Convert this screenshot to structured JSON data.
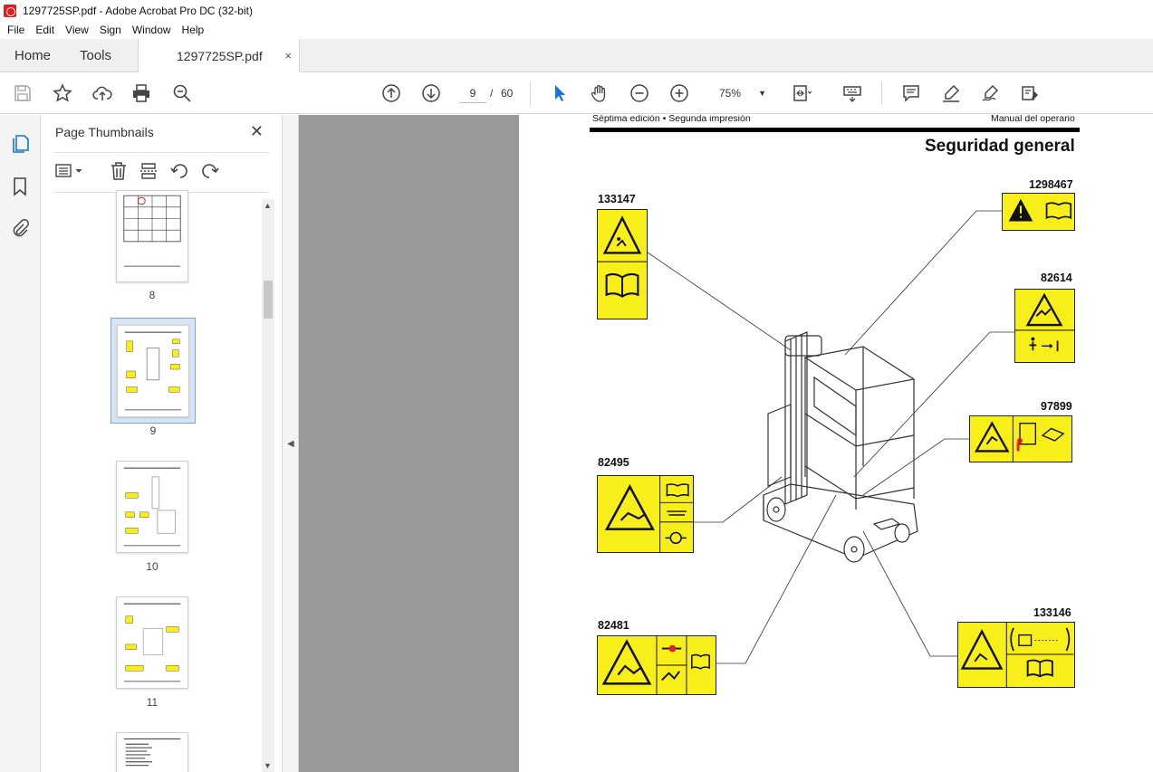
{
  "window": {
    "title": "1297725SP.pdf - Adobe Acrobat Pro DC (32-bit)"
  },
  "menu": [
    "File",
    "Edit",
    "View",
    "Sign",
    "Window",
    "Help"
  ],
  "tabs": {
    "home": "Home",
    "tools": "Tools",
    "document": "1297725SP.pdf",
    "close": "×"
  },
  "toolbar": {
    "current_page": "9",
    "page_sep": "/",
    "total_pages": "60",
    "zoom": "75%"
  },
  "thumbnails_panel": {
    "title": "Page Thumbnails",
    "close": "✕",
    "pages": [
      "8",
      "9",
      "10",
      "11"
    ],
    "selected_page": "9"
  },
  "document": {
    "header_left": "Séptima edición • Segunda impresión",
    "header_right": "Manual del operario",
    "section_title": "Seguridad general",
    "decal_numbers": {
      "d1": "133147",
      "d2": "1298467",
      "d3": "82614",
      "d4": "97899",
      "d5": "82495",
      "d6": "82481",
      "d7": "133146"
    }
  },
  "colors": {
    "decal_yellow": "#f7ee1a",
    "doc_bg": "#999999",
    "acrobat_red": "#e01e1e"
  }
}
